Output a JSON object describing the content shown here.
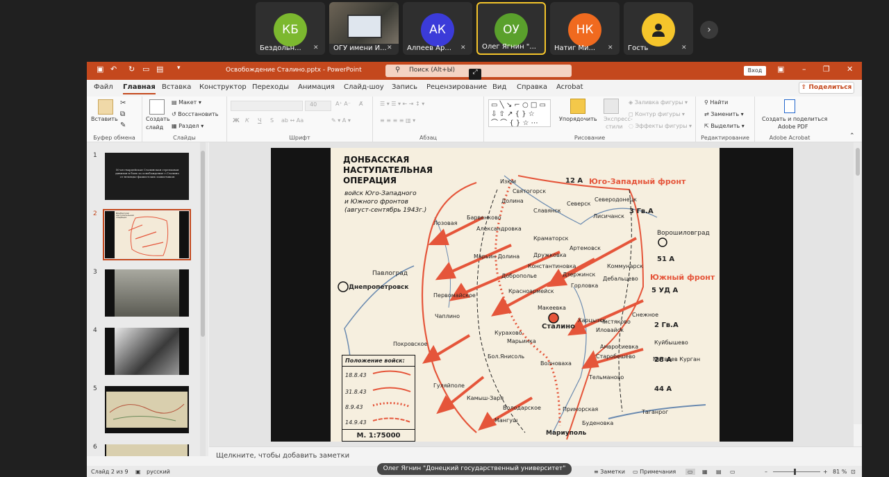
{
  "participants": [
    {
      "initials": "КБ",
      "name": "Бездольн...",
      "color": "#7cb82f"
    },
    {
      "initials": "",
      "name": "ОГУ имени И...",
      "color": ""
    },
    {
      "initials": "АК",
      "name": "Алпеев Ар...",
      "color": "#3b3bd9"
    },
    {
      "initials": "ОУ",
      "name": "Олег Ягнин \"...",
      "color": "#5aa02c"
    },
    {
      "initials": "НК",
      "name": "Натиг Ми...",
      "color": "#f06a1f"
    },
    {
      "initials": "",
      "name": "Гость",
      "color": "#f5c52b"
    }
  ],
  "window": {
    "title": "Освобождение Сталино.pptx  -  PowerPoint",
    "search_placeholder": "Поиск (Alt+Ы)",
    "login": "Вход",
    "share": "Поделиться"
  },
  "menu": [
    "Файл",
    "Главная",
    "Вставка",
    "Конструктор",
    "Переходы",
    "Анимация",
    "Слайд-шоу",
    "Запись",
    "Рецензирование",
    "Вид",
    "Справка",
    "Acrobat"
  ],
  "ribbon": {
    "clipboard": {
      "paste": "Вставить",
      "label": "Буфер обмена"
    },
    "slides": {
      "new": "Создать",
      "new2": "слайд",
      "layout": "Макет",
      "reset": "Восстановить",
      "section": "Раздел",
      "label": "Слайды"
    },
    "font": {
      "size": "40",
      "bold": "Ж",
      "italic": "К",
      "underline": "Ч",
      "strike": "S",
      "label": "Шрифт"
    },
    "paragraph": {
      "label": "Абзац"
    },
    "drawing": {
      "arrange": "Упорядочить",
      "quick": "Экспресс-",
      "quick2": "стили",
      "fill": "Заливка фигуры",
      "outline": "Контур фигуры",
      "effects": "Эффекты фигуры",
      "label": "Рисование"
    },
    "editing": {
      "find": "Найти",
      "replace": "Заменить",
      "select": "Выделить",
      "label": "Редактирование"
    },
    "acrobat": {
      "create": "Создать и поделиться",
      "create2": "Adobe PDF",
      "label": "Adobe Acrobat"
    }
  },
  "slides": [
    {
      "num": "1",
      "text": "50-ая гвардейская Сталинская стрелковая дивизия в боях за освобождение г.Сталино от немецко-фашистских захватчиков"
    },
    {
      "num": "2",
      "text": "Донбасская наступательная операция"
    },
    {
      "num": "3",
      "text": ""
    },
    {
      "num": "4",
      "text": ""
    },
    {
      "num": "5",
      "text": ""
    },
    {
      "num": "6",
      "text": ""
    }
  ],
  "map": {
    "title": [
      "ДОНБАССКАЯ",
      "НАСТУПАТЕЛЬНАЯ",
      "ОПЕРАЦИЯ"
    ],
    "subtitle": [
      "войск Юго-Западного",
      "и Южного фронтов",
      "(август-сентябрь 1943г.)"
    ],
    "front_sw": "Юго-Западный фронт",
    "front_s": "Южный фронт",
    "cities": [
      "Изюм",
      "Святогорск",
      "Северодонецк",
      "Лисичанск",
      "Ворошиловград",
      "Лозовая",
      "Барвенково",
      "Славянск",
      "Краматорск",
      "Северск",
      "Артемовск",
      "Дружковка",
      "Константиновка",
      "Доброполье",
      "Дзержинск",
      "Горловка",
      "Дебальцево",
      "Коммунарск",
      "Павлоград",
      "Днепропетровск",
      "Первомайское",
      "Красноармейск",
      "Макеевка",
      "Сталино",
      "Харцызск",
      "Снежное",
      "Чистяково",
      "Куйбышево",
      "Чаплино",
      "Курахово",
      "Марьинка",
      "Иловайск",
      "Амвросиевка",
      "Покровское",
      "Бол.Янисоль",
      "Волноваха",
      "Старобешево",
      "Матвеев Курган",
      "Гуляйполе",
      "Тельманово",
      "Камыш-Заря",
      "Володарское",
      "Приморская",
      "Буденовка",
      "Таганрог",
      "Мангуш",
      "Мариуполь",
      "Александровка",
      "Марьин Долина",
      "Долина"
    ],
    "armies": [
      "12 А",
      "3 Гв.А",
      "51 А",
      "5 УД А",
      "2 Гв.А",
      "28 А",
      "44 А"
    ],
    "legend_title": "Положение войск:",
    "legend_dates": [
      "18.8.43",
      "31.8.43",
      "8.9.43",
      "14.9.43"
    ],
    "scale": "М. 1:75000"
  },
  "notes_placeholder": "Щелкните, чтобы добавить заметки",
  "status": {
    "slide": "Слайд 2 из 9",
    "lang": "русский",
    "notes": "Заметки",
    "comments": "Примечания",
    "zoom": "81 %"
  },
  "speaker": "Олег Ягнин \"Донецкий государственный университет\""
}
